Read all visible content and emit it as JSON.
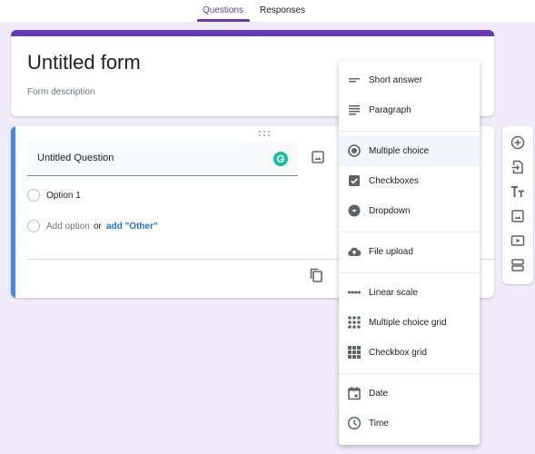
{
  "tabs": [
    {
      "label": "Questions",
      "active": true
    },
    {
      "label": "Responses",
      "active": false
    }
  ],
  "colors": {
    "accent": "#673ab7",
    "active_question_bar": "#4285f4",
    "background": "#f0ebf8",
    "link": "#1a73e8",
    "grammarly": "#15c39a"
  },
  "form": {
    "title": "Untitled form",
    "description_placeholder": "Form description"
  },
  "question": {
    "title": "Untitled Question",
    "options": [
      "Option 1"
    ],
    "add_option_label": "Add option",
    "or_label": "or",
    "add_other_label": "add \"Other\""
  },
  "type_menu": {
    "selected": "Multiple choice",
    "groups": [
      [
        {
          "label": "Short answer",
          "icon": "short-answer-icon"
        },
        {
          "label": "Paragraph",
          "icon": "paragraph-icon"
        }
      ],
      [
        {
          "label": "Multiple choice",
          "icon": "radio-button-icon"
        },
        {
          "label": "Checkboxes",
          "icon": "checkbox-icon"
        },
        {
          "label": "Dropdown",
          "icon": "dropdown-icon"
        }
      ],
      [
        {
          "label": "File upload",
          "icon": "cloud-upload-icon"
        }
      ],
      [
        {
          "label": "Linear scale",
          "icon": "linear-scale-icon"
        },
        {
          "label": "Multiple choice grid",
          "icon": "radio-grid-icon"
        },
        {
          "label": "Checkbox grid",
          "icon": "checkbox-grid-icon"
        }
      ],
      [
        {
          "label": "Date",
          "icon": "calendar-icon"
        },
        {
          "label": "Time",
          "icon": "clock-icon"
        }
      ]
    ]
  },
  "side_toolbar": [
    {
      "icon": "add-question-icon",
      "tooltip": "Add question"
    },
    {
      "icon": "import-questions-icon",
      "tooltip": "Import questions"
    },
    {
      "icon": "title-text-icon",
      "tooltip": "Add title and description"
    },
    {
      "icon": "image-icon",
      "tooltip": "Add image"
    },
    {
      "icon": "video-icon",
      "tooltip": "Add video"
    },
    {
      "icon": "section-icon",
      "tooltip": "Add section"
    }
  ]
}
